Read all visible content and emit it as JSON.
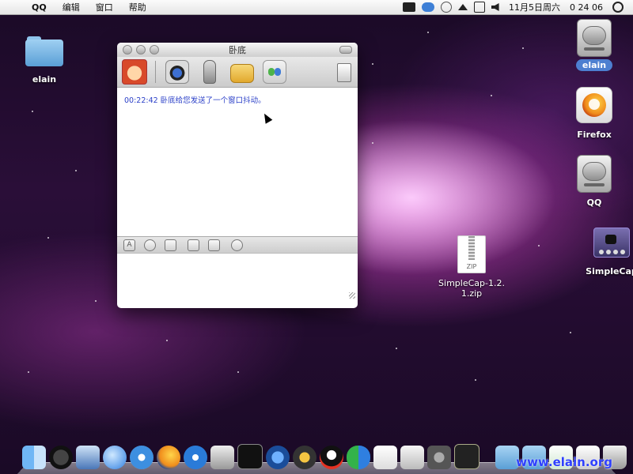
{
  "menubar": {
    "app_name": "QQ",
    "menus": [
      "编辑",
      "窗口",
      "帮助"
    ],
    "clock": "11月5日周六",
    "time": "0 24 06"
  },
  "desktop_icons": [
    {
      "label": "elain"
    },
    {
      "label": "elain"
    },
    {
      "label": "Firefox"
    },
    {
      "label": "QQ"
    },
    {
      "label": "SimpleCap"
    },
    {
      "label": "SimpleCap-1.2.1.zip",
      "line1": "SimpleCap-1.2.",
      "line2": "1.zip",
      "badge": "ZIP"
    }
  ],
  "chat_window": {
    "title": "卧底",
    "message": "00:22:42 卧底给您发送了一个窗口抖动。"
  },
  "watermark": "www.elain.org"
}
